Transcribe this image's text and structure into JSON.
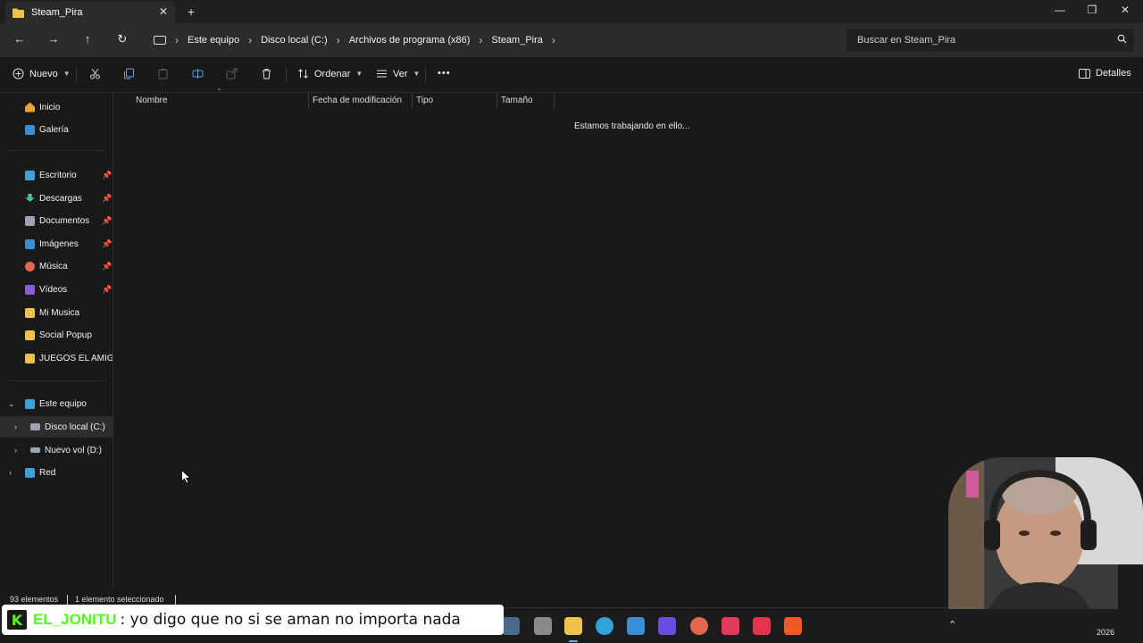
{
  "window": {
    "tab_title": "Steam_Pira",
    "close_tab": "✕",
    "new_tab": "+",
    "minimize": "—",
    "restore": "❐",
    "close": "✕"
  },
  "nav": {
    "back": "←",
    "forward": "→",
    "up": "↑",
    "refresh": "↻"
  },
  "breadcrumb": [
    "Este equipo",
    "Disco local (C:)",
    "Archivos de programa (x86)",
    "Steam_Pira"
  ],
  "search": {
    "placeholder": "Buscar en Steam_Pira"
  },
  "toolbar": {
    "new_label": "Nuevo",
    "sort_label": "Ordenar",
    "view_label": "Ver",
    "more": "•••",
    "details_label": "Detalles"
  },
  "sidebar": {
    "quick": [
      {
        "label": "Inicio",
        "icon": "home-icon",
        "color": "#e8a33d"
      },
      {
        "label": "Galería",
        "icon": "gallery-icon",
        "color": "#3b8fd9"
      }
    ],
    "pinned": [
      {
        "label": "Escritorio",
        "icon": "desktop-icon",
        "color": "#3fa0d8"
      },
      {
        "label": "Descargas",
        "icon": "download-icon",
        "color": "#4cc2a0"
      },
      {
        "label": "Documentos",
        "icon": "document-icon",
        "color": "#9aa4b2"
      },
      {
        "label": "Imágenes",
        "icon": "pictures-icon",
        "color": "#3b8fd9"
      },
      {
        "label": "Música",
        "icon": "music-icon",
        "color": "#e0664f"
      },
      {
        "label": "Vídeos",
        "icon": "videos-icon",
        "color": "#8a5cd6"
      }
    ],
    "folders": [
      {
        "label": "Mi Musica",
        "icon": "folder-icon",
        "color": "#f0c24b"
      },
      {
        "label": "Social Popup",
        "icon": "folder-icon",
        "color": "#f0c24b"
      },
      {
        "label": "JUEGOS EL AMIGOS",
        "icon": "folder-icon",
        "color": "#f0c24b"
      }
    ],
    "pc": {
      "label": "Este equipo",
      "icon": "computer-icon",
      "color": "#3fa0d8"
    },
    "drives": [
      {
        "label": "Disco local (C:)",
        "icon": "drive-icon",
        "color": "#9aa4b2"
      },
      {
        "label": "Nuevo vol (D:)",
        "icon": "drive-icon",
        "color": "#9aa4b2"
      }
    ],
    "network": {
      "label": "Red",
      "icon": "network-icon",
      "color": "#3fa0d8"
    }
  },
  "columns": [
    "Nombre",
    "Fecha de modificación",
    "Tipo",
    "Tamaño"
  ],
  "main": {
    "working_text": "Estamos trabajando en ello..."
  },
  "status": {
    "count": "93 elementos",
    "selected": "1 elemento seleccionado"
  },
  "chat": {
    "user": "EL_JONITU",
    "message": ": yo digo que no si se aman no importa nada"
  },
  "taskbar": {
    "apps": [
      {
        "name": "taskview",
        "color": "#8a8a8a"
      },
      {
        "name": "file-explorer",
        "color": "#f0c24b"
      },
      {
        "name": "edge",
        "color": "#2fa4d9"
      },
      {
        "name": "store",
        "color": "#3b8fd9"
      },
      {
        "name": "obs",
        "color": "#6b4ce0"
      },
      {
        "name": "app-red",
        "color": "#e0664f"
      },
      {
        "name": "app-pink",
        "color": "#e23a5a"
      },
      {
        "name": "tiktok",
        "color": "#e2334f"
      },
      {
        "name": "brave",
        "color": "#f05a28"
      }
    ],
    "tray_arrow": "⌃",
    "year": "2026"
  }
}
